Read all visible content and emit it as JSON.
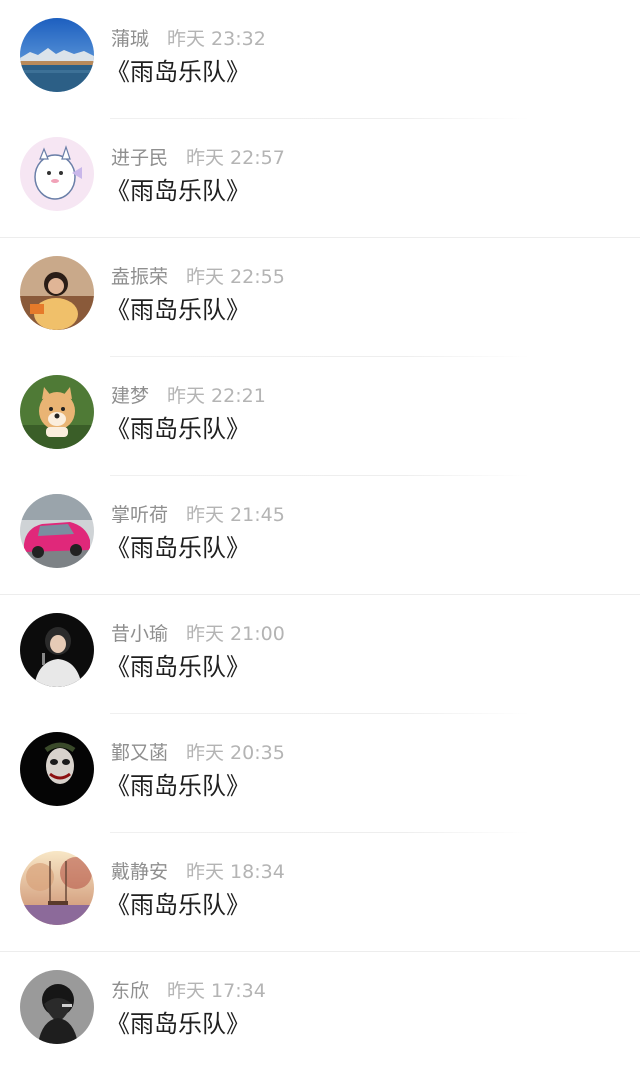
{
  "comments": [
    {
      "name": "蒲珹",
      "time": "昨天 23:32",
      "text": "《雨岛乐队》",
      "avatar_icon": "landscape-lake-avatar-icon"
    },
    {
      "name": "进子民",
      "time": "昨天 22:57",
      "text": "《雨岛乐队》",
      "avatar_icon": "cartoon-unicorn-avatar-icon"
    },
    {
      "name": "盍振荣",
      "time": "昨天 22:55",
      "text": "《雨岛乐队》",
      "avatar_icon": "woman-photo-avatar-icon"
    },
    {
      "name": "建梦",
      "time": "昨天 22:21",
      "text": "《雨岛乐队》",
      "avatar_icon": "pomeranian-dog-avatar-icon"
    },
    {
      "name": "掌听荷",
      "time": "昨天 21:45",
      "text": "《雨岛乐队》",
      "avatar_icon": "pink-car-avatar-icon"
    },
    {
      "name": "昔小瑜",
      "time": "昨天 21:00",
      "text": "《雨岛乐队》",
      "avatar_icon": "singer-photo-avatar-icon"
    },
    {
      "name": "鄞又菡",
      "time": "昨天 20:35",
      "text": "《雨岛乐队》",
      "avatar_icon": "joker-face-avatar-icon"
    },
    {
      "name": "戴静安",
      "time": "昨天 18:34",
      "text": "《雨岛乐队》",
      "avatar_icon": "sunset-swing-avatar-icon"
    },
    {
      "name": "东欣",
      "time": "昨天 17:34",
      "text": "《雨岛乐队》",
      "avatar_icon": "dark-portrait-avatar-icon"
    }
  ]
}
